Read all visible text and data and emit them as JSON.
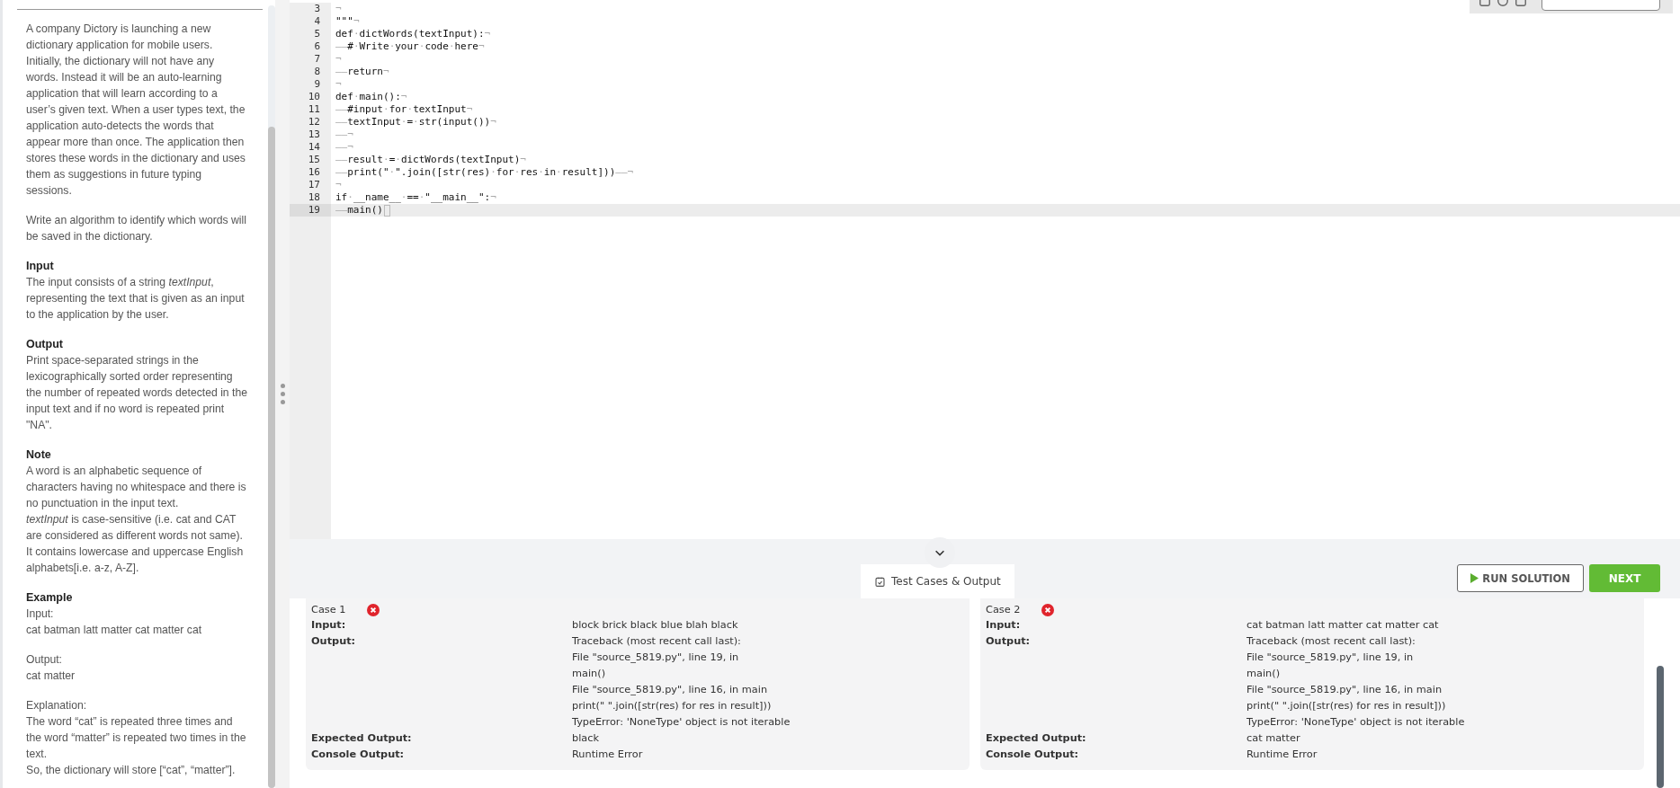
{
  "description": [
    {
      "kind": "paragraph",
      "text": "A company Dictory is launching a new dictionary application for mobile users. Initially, the dictionary will not have any words. Instead it will be an auto-learning application that will learn according to a user’s given text. When a user types text, the application auto-detects the words that appear more than once. The application then stores these words in the dictionary and uses them as suggestions in future typing sessions."
    },
    {
      "kind": "gap"
    },
    {
      "kind": "paragraph",
      "text": "Write an algorithm to identify which words will be saved in the dictionary."
    },
    {
      "kind": "gap"
    },
    {
      "kind": "heading",
      "text": "Input"
    },
    {
      "kind": "paragraph",
      "text": "The input consists of a string *textInput*, representing the text that is given as an input to the application by the user."
    },
    {
      "kind": "gap"
    },
    {
      "kind": "heading",
      "text": "Output"
    },
    {
      "kind": "paragraph",
      "text": "Print space-separated strings in the lexicographically sorted order representing the number of repeated words detected in the input text and if no word is repeated print \"NA\"."
    },
    {
      "kind": "gap"
    },
    {
      "kind": "heading",
      "text": "Note"
    },
    {
      "kind": "paragraph",
      "text": "A word is an alphabetic sequence of characters having no whitespace and there is no punctuation in the input text."
    },
    {
      "kind": "paragraph",
      "text": "*textInput* is case-sensitive (i.e. cat and CAT are considered as different words not same)."
    },
    {
      "kind": "paragraph",
      "text": "It contains lowercase and uppercase English alphabets[i.e. a-z, A-Z]."
    },
    {
      "kind": "gap"
    },
    {
      "kind": "heading",
      "text": "Example"
    },
    {
      "kind": "paragraph",
      "text": "Input:"
    },
    {
      "kind": "paragraph",
      "text": "cat batman latt matter cat matter cat"
    },
    {
      "kind": "gap"
    },
    {
      "kind": "paragraph",
      "text": "Output:"
    },
    {
      "kind": "paragraph",
      "text": "cat matter"
    },
    {
      "kind": "gap"
    },
    {
      "kind": "paragraph",
      "text": "Explanation:"
    },
    {
      "kind": "paragraph",
      "text": "The word “cat” is repeated three times and the word “matter” is repeated two times in the text."
    },
    {
      "kind": "paragraph",
      "text": "So, the dictionary will store [“cat”, “matter”]."
    }
  ],
  "editor": {
    "lines": [
      {
        "number": "3",
        "code": "¬",
        "selected": false
      },
      {
        "number": "4",
        "code": "\"\"\"¬",
        "selected": false
      },
      {
        "number": "5",
        "code": "def·dictWords(textInput):¬",
        "selected": false
      },
      {
        "number": "6",
        "code": "——#·Write·your·code·here¬",
        "selected": false
      },
      {
        "number": "7",
        "code": "¬",
        "selected": false
      },
      {
        "number": "8",
        "code": "——return¬",
        "selected": false
      },
      {
        "number": "9",
        "code": "¬",
        "selected": false
      },
      {
        "number": "10",
        "code": "def·main():¬",
        "selected": false
      },
      {
        "number": "11",
        "code": "——#input·for·textInput¬",
        "selected": false
      },
      {
        "number": "12",
        "code": "——textInput·=·str(input())¬",
        "selected": false
      },
      {
        "number": "13",
        "code": "——¬",
        "selected": false
      },
      {
        "number": "14",
        "code": "——¬",
        "selected": false
      },
      {
        "number": "15",
        "code": "——result·=·dictWords(textInput)¬",
        "selected": false
      },
      {
        "number": "16",
        "code": "——print(\"·\".join([str(res)·for·res·in·result]))——¬",
        "selected": false
      },
      {
        "number": "17",
        "code": "¬",
        "selected": false
      },
      {
        "number": "18",
        "code": "if·__name__·==·\"__main__\":¬",
        "selected": false
      },
      {
        "number": "19",
        "code": "——main()",
        "selected": true
      }
    ]
  },
  "output_tab": {
    "label": "Test Cases & Output"
  },
  "buttons": {
    "run": "RUN SOLUTION",
    "next": "NEXT"
  },
  "cases": [
    {
      "title": "Case 1",
      "passed": false,
      "rows": [
        {
          "label": "Input:",
          "lines": [
            "block brick black blue blah black"
          ]
        },
        {
          "label": "Output:",
          "lines": [
            "Traceback (most recent call last):",
            "File \"source_5819.py\", line 19, in",
            "main()",
            "File \"source_5819.py\", line 16, in main",
            "print(\" \".join([str(res) for res in result]))",
            "TypeError: 'NoneType' object is not iterable"
          ]
        },
        {
          "label": "Expected Output:",
          "lines": [
            "black"
          ]
        },
        {
          "label": "Console Output:",
          "lines": [
            "Runtime Error"
          ]
        }
      ]
    },
    {
      "title": "Case 2",
      "passed": false,
      "rows": [
        {
          "label": "Input:",
          "lines": [
            "cat batman latt matter cat matter cat"
          ]
        },
        {
          "label": "Output:",
          "lines": [
            "Traceback (most recent call last):",
            "File \"source_5819.py\", line 19, in",
            "main()",
            "File \"source_5819.py\", line 16, in main",
            "print(\" \".join([str(res) for res in result]))",
            "TypeError: 'NoneType' object is not iterable"
          ]
        },
        {
          "label": "Expected Output:",
          "lines": [
            "cat matter"
          ]
        },
        {
          "label": "Console Output:",
          "lines": [
            "Runtime Error"
          ]
        }
      ]
    }
  ]
}
